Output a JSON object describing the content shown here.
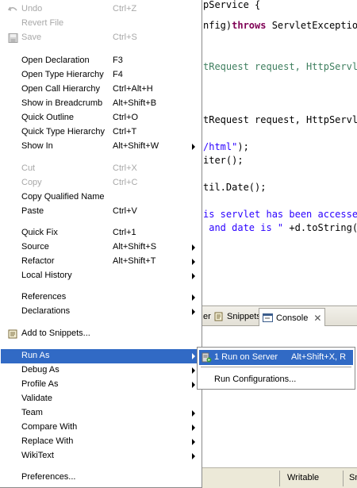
{
  "editor": {
    "lines": [
      {
        "pre": "",
        "text": "pService {",
        "kw": "",
        "post": ""
      },
      {
        "pre": "nfig)",
        "kw": "throws",
        "post": " ServletExceptio"
      },
      {
        "cm": "tRequest request, HttpServle"
      },
      {
        "pre": "tRequest request, HttpServle"
      },
      {
        "str": "/html\"",
        "post": ");"
      },
      {
        "pre": "iter();"
      },
      {
        "pre": "til.Date();"
      },
      {
        "str": "is servlet has been accessed"
      },
      {
        "str": " and date is \"",
        "post": " +d.toString()"
      }
    ]
  },
  "tabs": {
    "partial_left": "er",
    "snippets": "Snippets",
    "console": "Console"
  },
  "status": {
    "writable": "Writable",
    "partial": "Sm"
  },
  "menu": {
    "undo": {
      "label": "Undo",
      "shortcut": "Ctrl+Z"
    },
    "revert_file": {
      "label": "Revert File"
    },
    "save": {
      "label": "Save",
      "shortcut": "Ctrl+S"
    },
    "open_declaration": {
      "label": "Open Declaration",
      "shortcut": "F3"
    },
    "open_type_hierarchy": {
      "label": "Open Type Hierarchy",
      "shortcut": "F4"
    },
    "open_call_hierarchy": {
      "label": "Open Call Hierarchy",
      "shortcut": "Ctrl+Alt+H"
    },
    "show_in_breadcrumb": {
      "label": "Show in Breadcrumb",
      "shortcut": "Alt+Shift+B"
    },
    "quick_outline": {
      "label": "Quick Outline",
      "shortcut": "Ctrl+O"
    },
    "quick_type_hierarchy": {
      "label": "Quick Type Hierarchy",
      "shortcut": "Ctrl+T"
    },
    "show_in": {
      "label": "Show In",
      "shortcut": "Alt+Shift+W"
    },
    "cut": {
      "label": "Cut",
      "shortcut": "Ctrl+X"
    },
    "copy": {
      "label": "Copy",
      "shortcut": "Ctrl+C"
    },
    "copy_qualified_name": {
      "label": "Copy Qualified Name"
    },
    "paste": {
      "label": "Paste",
      "shortcut": "Ctrl+V"
    },
    "quick_fix": {
      "label": "Quick Fix",
      "shortcut": "Ctrl+1"
    },
    "source": {
      "label": "Source",
      "shortcut": "Alt+Shift+S"
    },
    "refactor": {
      "label": "Refactor",
      "shortcut": "Alt+Shift+T"
    },
    "local_history": {
      "label": "Local History"
    },
    "references": {
      "label": "References"
    },
    "declarations": {
      "label": "Declarations"
    },
    "add_to_snippets": {
      "label": "Add to Snippets..."
    },
    "run_as": {
      "label": "Run As"
    },
    "debug_as": {
      "label": "Debug As"
    },
    "profile_as": {
      "label": "Profile As"
    },
    "validate": {
      "label": "Validate"
    },
    "team": {
      "label": "Team"
    },
    "compare_with": {
      "label": "Compare With"
    },
    "replace_with": {
      "label": "Replace With"
    },
    "wikitext": {
      "label": "WikiText"
    },
    "preferences": {
      "label": "Preferences..."
    }
  },
  "submenu": {
    "run_on_server": {
      "label": "1 Run on Server",
      "shortcut": "Alt+Shift+X, R"
    },
    "run_configurations": {
      "label": "Run Configurations..."
    }
  },
  "colors": {
    "highlight": "#316ac5",
    "keyword": "#7f0055",
    "string": "#2a00ff",
    "comment": "#3f7f5f",
    "disabled_text": "#a8a8a8"
  }
}
